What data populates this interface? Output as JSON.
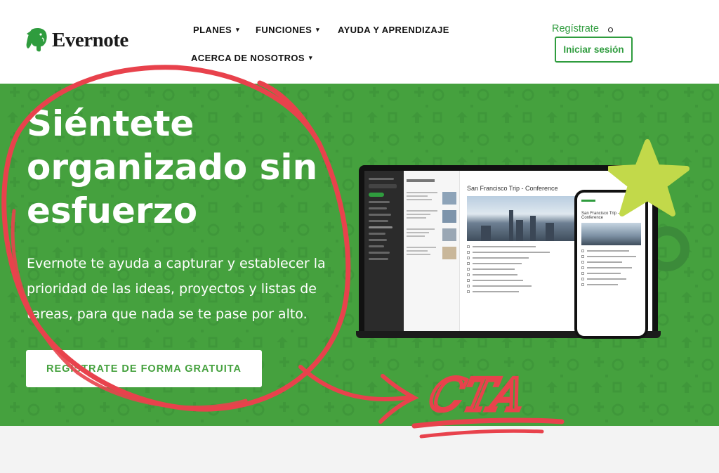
{
  "header": {
    "logo_text": "Evernote",
    "nav": [
      {
        "label": "PLANES",
        "has_caret": true
      },
      {
        "label": "FUNCIONES",
        "has_caret": true
      },
      {
        "label": "AYUDA Y APRENDIZAJE",
        "has_caret": false
      },
      {
        "label": "ACERCA DE NOSOTROS",
        "has_caret": true
      }
    ],
    "caret_glyph": "▾",
    "register_label": "Regístrate",
    "login_label": "Iniciar sesión"
  },
  "hero": {
    "title": "Siéntete organizado sin esfuerzo",
    "subtitle": "Evernote te ayuda a capturar y establecer la prioridad de las ideas, proyectos y listas de tareas, para que nada se te pase por alto.",
    "cta_label": "REGÍSTRATE DE FORMA GRATUITA"
  },
  "product_preview": {
    "note_title": "San Francisco Trip - Conference",
    "phone_note_title": "San Francisco Trip - Conference"
  },
  "annotation": {
    "label": "CTA"
  },
  "colors": {
    "brand_green": "#2f9c3e",
    "hero_green": "#45a13e",
    "annotation_red": "#e8424c",
    "star_lime": "#c2d94a"
  }
}
